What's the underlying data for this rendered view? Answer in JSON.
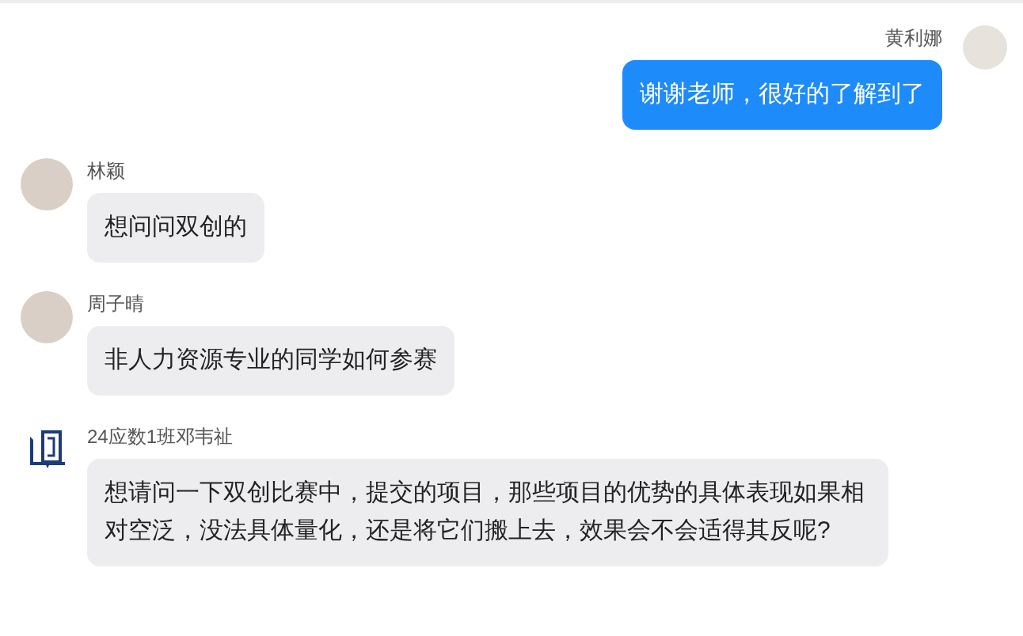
{
  "messages": [
    {
      "kind": "self",
      "sender": "黄利娜",
      "avatar": {
        "kind": "photo"
      },
      "text": "谢谢老师，很好的了解到了"
    },
    {
      "kind": "other",
      "sender": "林颖",
      "avatar": {
        "kind": "photo"
      },
      "text": "想问问双创的"
    },
    {
      "kind": "other",
      "sender": "周子晴",
      "avatar": {
        "kind": "photo"
      },
      "text": "非人力资源专业的同学如何参赛"
    },
    {
      "kind": "other",
      "sender": "24应数1班邓韦祉",
      "avatar": {
        "kind": "logo"
      },
      "text": "想请问一下双创比赛中，提交的项目，那些项目的优势的具体表现如果相对空泛，没法具体量化，还是将它们搬上去，效果会不会适得其反呢?"
    }
  ]
}
